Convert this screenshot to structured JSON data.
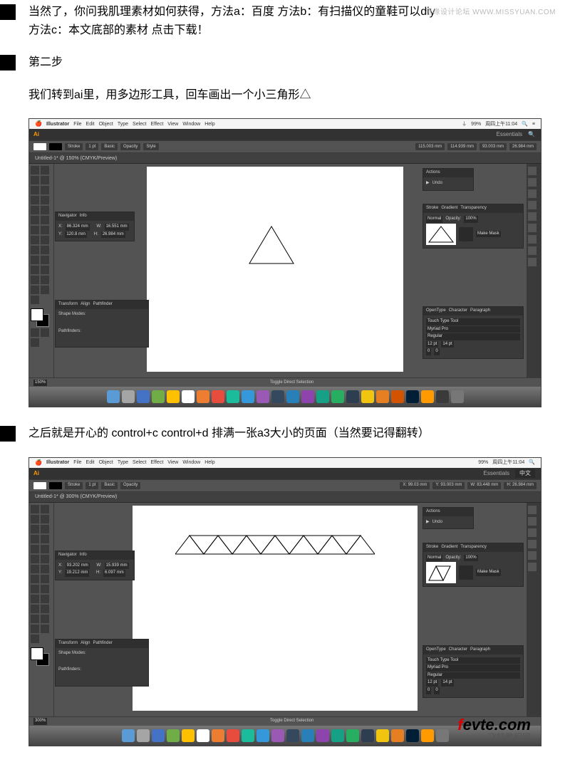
{
  "watermark_top": "思缘设计论坛   WWW.MISSYUAN.COM",
  "intro": {
    "line1": "当然了，你问我肌理素材如何获得，方法a：百度 方法b：有扫描仪的童鞋可以diy",
    "line2": "方法c：本文底部的素材 点击下载！"
  },
  "step2_title": "第二步",
  "step2_text": "我们转到ai里，用多边形工具，回车画出一个小三角形△",
  "step3_text": "之后就是开心的  control+c control+d 排满一张a3大小的页面（当然要记得翻转）",
  "mac_menu": {
    "app": "Illustrator",
    "items": [
      "File",
      "Edit",
      "Object",
      "Type",
      "Select",
      "Effect",
      "View",
      "Window",
      "Help"
    ]
  },
  "mac_status": {
    "battery": "99%",
    "time": "周四上午11:04",
    "lang": "中文"
  },
  "ai_top": {
    "workspace": "Essentials"
  },
  "control_bar": {
    "label": "Stroke",
    "stroke_pt": "1 pt",
    "opacity_label": "Opacity",
    "style": "Style",
    "basic": "Basic",
    "x": "115.003 mm",
    "y": "114.939 mm",
    "w": "93.003 mm",
    "h": "26.984 mm"
  },
  "doc_tab1": "Untitled-1* @ 150% (CMYK/Preview)",
  "doc_tab2": "Untitled-1* @ 300% (CMYK/Preview)",
  "panels": {
    "actions": {
      "title": "Actions",
      "undo": "Undo"
    },
    "navigator": {
      "tabs": [
        "Navigator",
        "Info"
      ],
      "x_label": "X:",
      "x": "86.324 mm",
      "y_label": "Y:",
      "y": "120.8 mm",
      "w_label": "W:",
      "w": "16.551 mm",
      "h_label": "H:",
      "h": "26.984 mm"
    },
    "navigator2": {
      "x": "93.202 mm",
      "y": "19.212 mm",
      "w": "15.939 mm",
      "h": "6.097 mm"
    },
    "pathfinder": {
      "tabs": [
        "Transform",
        "Align",
        "Pathfinder"
      ],
      "row1": "Shape Modes:",
      "row2": "Pathfinders:"
    },
    "stroke": {
      "tabs": [
        "Stroke",
        "Gradient",
        "Transparency"
      ],
      "mode": "Normal",
      "opacity_label": "Opacity:",
      "opacity": "100%",
      "mask": "Make Mask"
    },
    "character": {
      "tabs": [
        "OpenType",
        "Character",
        "Paragraph"
      ],
      "touch": "Touch Type Tool",
      "font": "Myriad Pro",
      "style": "Regular",
      "size": "12 pt"
    }
  },
  "status": {
    "zoom1": "150%",
    "zoom2": "300%",
    "mode": "Toggle Direct Selection"
  },
  "dock_colors": [
    "#5b9bd5",
    "#a5a5a5",
    "#b84cff",
    "#4472c4",
    "#70ad47",
    "#ffc000",
    "#ed7d31",
    "#e74c3c",
    "#c00000",
    "#1abc9c",
    "#3498db",
    "#9b59b6",
    "#34495e",
    "#16a085",
    "#27ae60",
    "#2980b9",
    "#8e44ad",
    "#2c3e50",
    "#f1c40f",
    "#e67e22",
    "#d35400",
    "#7f8c8d",
    "#9C27B0",
    "#001E36",
    "#FF9A00",
    "#3a3a3a",
    "#777"
  ],
  "fevte": {
    "f": "f",
    "rest": "evte.com",
    "sub": "飞特教程网"
  },
  "chart_data": {
    "type": "diagram",
    "figure1": {
      "shape": "triangle",
      "count": 1,
      "description": "single outlined equilateral triangle centered on artboard"
    },
    "figure2": {
      "shape": "triangle_strip",
      "count_up": 7,
      "count_down": 6,
      "description": "row of alternating up/down outlined triangles forming a zig-zag strip"
    }
  }
}
